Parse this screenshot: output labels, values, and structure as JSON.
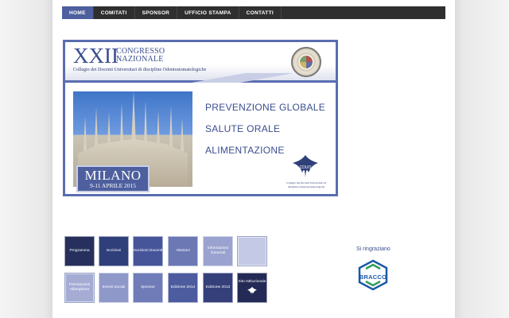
{
  "nav": {
    "items": [
      {
        "label": "HOME",
        "active": true
      },
      {
        "label": "COMITATI",
        "active": false
      },
      {
        "label": "SPONSOR",
        "active": false
      },
      {
        "label": "UFFICIO STAMPA",
        "active": false
      },
      {
        "label": "CONTATTI",
        "active": false
      }
    ]
  },
  "banner": {
    "edition": "XXII",
    "congresso_line1": "CONGRESSO",
    "congresso_line2": "NAZIONALE",
    "collegio": "Collegio dei Docenti Universitari di discipline Odontostomatologiche",
    "city": "MILANO",
    "dates": "9-11 APRILE 2015",
    "topics": [
      "PREVENZIONE GLOBALE",
      "SALUTE ORALE",
      "ALIMENTAZIONE"
    ],
    "logo_caption": "Collegio dei Docenti Universitari di discipline Odontostomatologiche",
    "logo_letters": "CDUO"
  },
  "tiles": [
    {
      "label": "Programma",
      "color": "#27305c"
    },
    {
      "label": "Iscrizioni",
      "color": "#2f3f7a"
    },
    {
      "label": "Iscrizioni Docenti",
      "color": "#46559a"
    },
    {
      "label": "Abstract",
      "color": "#6b78b4"
    },
    {
      "label": "Informazioni Generali",
      "color": "#9aa3cf"
    },
    {
      "label": "",
      "color": "#c4c9e6"
    },
    {
      "label": "Prenotazioni Alberghiere",
      "color": "#a4acd4"
    },
    {
      "label": "Eventi Sociali",
      "color": "#8e98c9"
    },
    {
      "label": "Sponsor",
      "color": "#6f7cb8"
    },
    {
      "label": "Edizione 2014",
      "color": "#4d5c9e"
    },
    {
      "label": "Edizione 2013",
      "color": "#353f7a"
    },
    {
      "label": "Sito Istituzionale",
      "color": "#222a55"
    }
  ],
  "sponsors": {
    "thanks": "Si ringraziano",
    "bracco": "BRACCO"
  },
  "icons": {
    "logo": "cduo-logo-icon",
    "seal": "congress-seal-icon",
    "bracco": "bracco-logo-icon"
  }
}
